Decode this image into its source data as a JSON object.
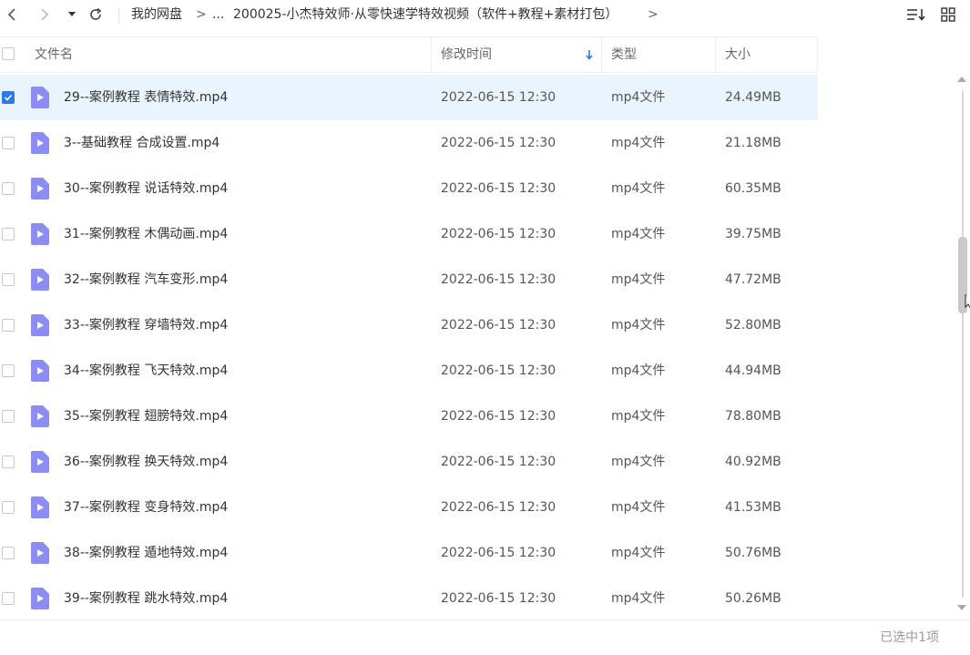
{
  "breadcrumb": {
    "root": "我的网盘",
    "sep": ">",
    "ellipsis": "...",
    "current": "200025-小杰特效师·从零快速学特效视频（软件+教程+素材打包）",
    "trail_sep": ">"
  },
  "columns": {
    "name": "文件名",
    "modified": "修改时间",
    "type": "类型",
    "size": "大小"
  },
  "files": [
    {
      "name": "29--案例教程 表情特效.mp4",
      "modified": "2022-06-15 12:30",
      "type": "mp4文件",
      "size": "24.49MB",
      "selected": true
    },
    {
      "name": "3--基础教程 合成设置.mp4",
      "modified": "2022-06-15 12:30",
      "type": "mp4文件",
      "size": "21.18MB",
      "selected": false
    },
    {
      "name": "30--案例教程 说话特效.mp4",
      "modified": "2022-06-15 12:30",
      "type": "mp4文件",
      "size": "60.35MB",
      "selected": false
    },
    {
      "name": "31--案例教程 木偶动画.mp4",
      "modified": "2022-06-15 12:30",
      "type": "mp4文件",
      "size": "39.75MB",
      "selected": false
    },
    {
      "name": "32--案例教程 汽车变形.mp4",
      "modified": "2022-06-15 12:30",
      "type": "mp4文件",
      "size": "47.72MB",
      "selected": false
    },
    {
      "name": "33--案例教程 穿墙特效.mp4",
      "modified": "2022-06-15 12:30",
      "type": "mp4文件",
      "size": "52.80MB",
      "selected": false
    },
    {
      "name": "34--案例教程 飞天特效.mp4",
      "modified": "2022-06-15 12:30",
      "type": "mp4文件",
      "size": "44.94MB",
      "selected": false
    },
    {
      "name": "35--案例教程 翅膀特效.mp4",
      "modified": "2022-06-15 12:30",
      "type": "mp4文件",
      "size": "78.80MB",
      "selected": false
    },
    {
      "name": "36--案例教程 换天特效.mp4",
      "modified": "2022-06-15 12:30",
      "type": "mp4文件",
      "size": "40.92MB",
      "selected": false
    },
    {
      "name": "37--案例教程 变身特效.mp4",
      "modified": "2022-06-15 12:30",
      "type": "mp4文件",
      "size": "41.53MB",
      "selected": false
    },
    {
      "name": "38--案例教程 遁地特效.mp4",
      "modified": "2022-06-15 12:30",
      "type": "mp4文件",
      "size": "50.76MB",
      "selected": false
    },
    {
      "name": "39--案例教程 跳水特效.mp4",
      "modified": "2022-06-15 12:30",
      "type": "mp4文件",
      "size": "50.26MB",
      "selected": false
    }
  ],
  "status": "已选中1项",
  "icons": {
    "back": "chevron-left-icon",
    "forward": "chevron-right-icon",
    "dropdown": "caret-down-icon",
    "refresh": "refresh-icon",
    "sort": "sort-list-icon",
    "view": "grid-view-icon",
    "file": "video-file-icon"
  },
  "colors": {
    "accent": "#2c7be5",
    "selected_row": "#e9f4ff",
    "file_icon": "#8c8cf5"
  }
}
